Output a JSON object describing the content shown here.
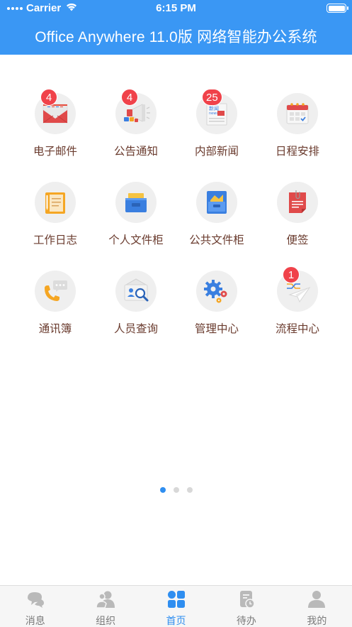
{
  "status_bar": {
    "carrier": "Carrier",
    "time": "6:15 PM"
  },
  "header": {
    "title": "Office Anywhere 11.0版 网络智能办公系统"
  },
  "apps": [
    {
      "label": "电子邮件",
      "badge": "4",
      "icon": "mail-icon"
    },
    {
      "label": "公告通知",
      "badge": "4",
      "icon": "megaphone-icon"
    },
    {
      "label": "内部新闻",
      "badge": "25",
      "icon": "newspaper-icon",
      "icon_text": [
        "新闻",
        "news"
      ]
    },
    {
      "label": "日程安排",
      "badge": "",
      "icon": "calendar-icon"
    },
    {
      "label": "工作日志",
      "badge": "",
      "icon": "notebook-icon"
    },
    {
      "label": "个人文件柜",
      "badge": "",
      "icon": "drawer-icon"
    },
    {
      "label": "公共文件柜",
      "badge": "",
      "icon": "shared-folder-icon"
    },
    {
      "label": "便签",
      "badge": "",
      "icon": "sticky-note-icon"
    },
    {
      "label": "通讯簿",
      "badge": "",
      "icon": "phone-icon"
    },
    {
      "label": "人员查询",
      "badge": "",
      "icon": "person-search-icon"
    },
    {
      "label": "管理中心",
      "badge": "",
      "icon": "gears-icon"
    },
    {
      "label": "流程中心",
      "badge": "1",
      "icon": "paper-plane-icon"
    }
  ],
  "pager": {
    "pages": 3,
    "current": 1
  },
  "tabbar": [
    {
      "label": "消息",
      "icon": "chat-bubble-icon",
      "active": false
    },
    {
      "label": "组织",
      "icon": "people-icon",
      "active": false
    },
    {
      "label": "首页",
      "icon": "home-grid-icon",
      "active": true
    },
    {
      "label": "待办",
      "icon": "todo-clock-icon",
      "active": false
    },
    {
      "label": "我的",
      "icon": "user-icon",
      "active": false
    }
  ],
  "colors": {
    "header": "#3a97f4",
    "badge": "#f0424a",
    "label": "#6a3b2e",
    "active_tab": "#2f8ef0",
    "inactive_tab": "#b9b9b9"
  }
}
